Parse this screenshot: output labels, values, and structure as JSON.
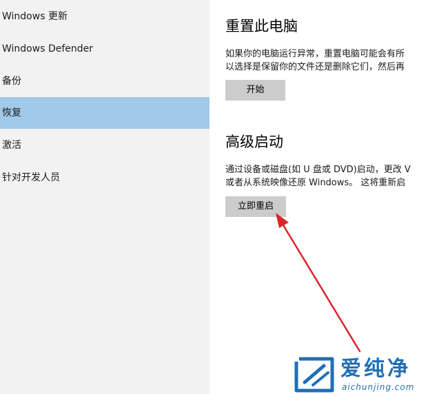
{
  "sidebar": {
    "items": [
      {
        "label": "Windows 更新",
        "selected": false
      },
      {
        "label": "Windows Defender",
        "selected": false
      },
      {
        "label": "备份",
        "selected": false
      },
      {
        "label": "恢复",
        "selected": true
      },
      {
        "label": "激活",
        "selected": false
      },
      {
        "label": "针对开发人员",
        "selected": false
      }
    ]
  },
  "reset": {
    "title": "重置此电脑",
    "desc_line1": "如果你的电脑运行异常，重置电脑可能会有所",
    "desc_line2": "以选择是保留你的文件还是删除它们，然后再",
    "button_label": "开始"
  },
  "advanced": {
    "title": "高级启动",
    "desc_line1": "通过设备或磁盘(如 U 盘或 DVD)启动，更改 V",
    "desc_line2": "或者从系统映像还原 Windows。 这将重新启",
    "button_label": "立即重启"
  },
  "watermark": {
    "brand": "爱纯净",
    "url": "aichunjing.com"
  },
  "colors": {
    "sidebar_bg": "#f2f2f2",
    "selected_bg": "#a2c9e8",
    "button_bg": "#cccccc",
    "arrow": "#d9262a",
    "watermark": "#1f6fb8"
  }
}
